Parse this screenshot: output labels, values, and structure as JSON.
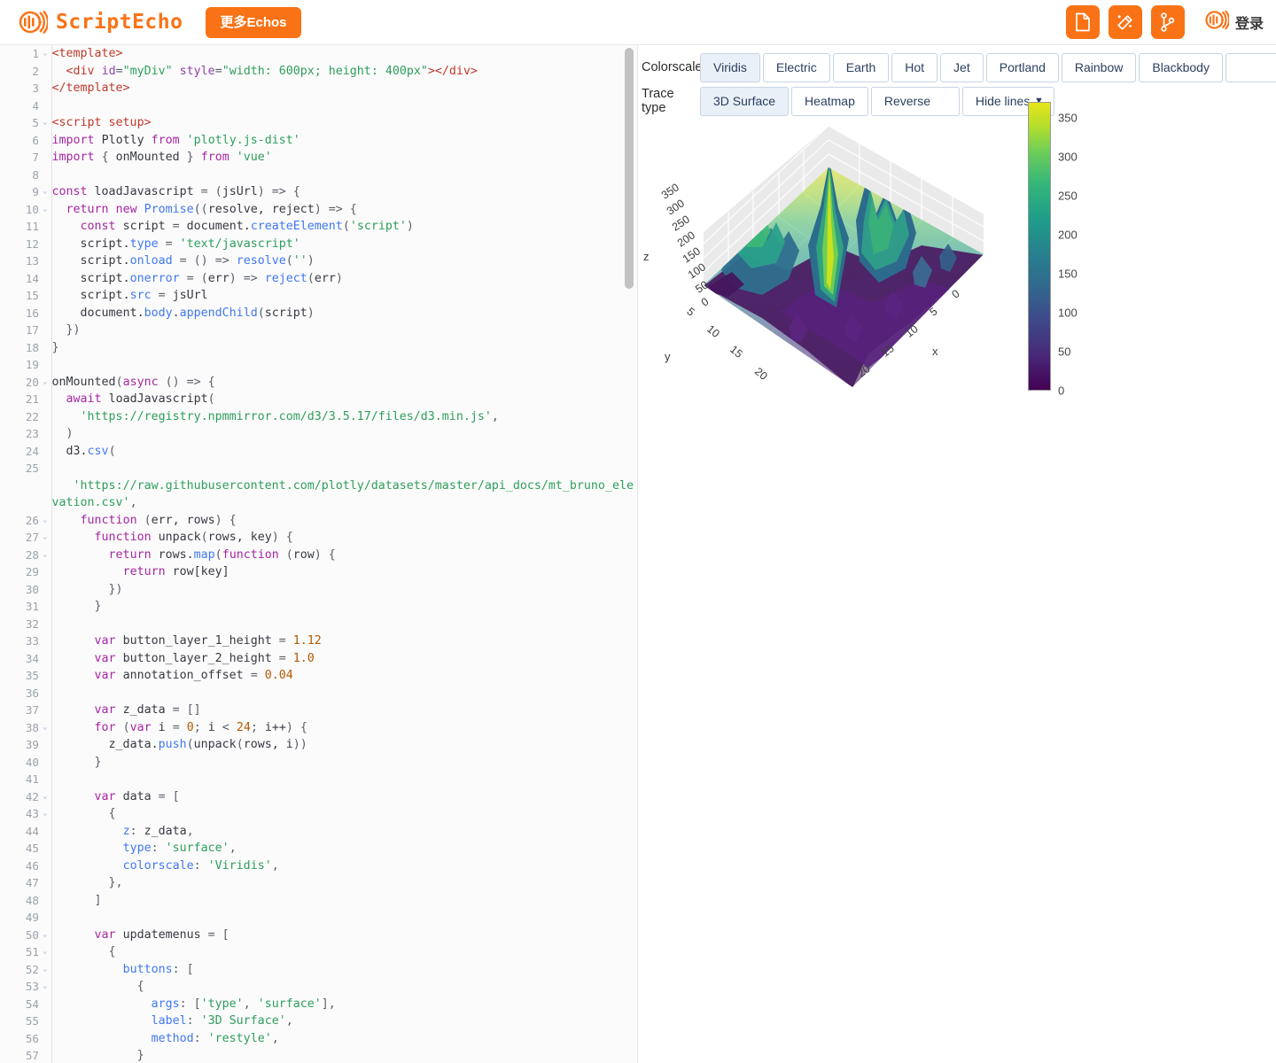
{
  "header": {
    "brand_name": "ScriptEcho",
    "logo_icon": "echo-wave-logo",
    "more_button_label": "更多Echos",
    "action_buttons": [
      {
        "name": "new-document-button",
        "icon": "document-icon"
      },
      {
        "name": "magic-wand-button",
        "icon": "magic-wand-icon"
      },
      {
        "name": "branch-button",
        "icon": "git-branch-icon"
      }
    ],
    "login_label": "登录",
    "login_icon": "echo-wave-logo",
    "accent_color": "#f97316"
  },
  "editor": {
    "name": "vue-code-editor",
    "language": "vue",
    "first_visible_line": 1,
    "last_visible_line": 57,
    "scrollbar_visible": true,
    "lines": [
      {
        "n": 1,
        "fold": true,
        "html": "<span class=\"tag\">&lt;template&gt;</span>"
      },
      {
        "n": 2,
        "fold": false,
        "html": "  <span class=\"tag\">&lt;div</span> <span class=\"attr\">id</span><span class=\"punc\">=</span><span class=\"str\">\"myDiv\"</span> <span class=\"attr\">style</span><span class=\"punc\">=</span><span class=\"str\">\"width: 600px; height: 400px\"</span><span class=\"tag\">&gt;&lt;/div&gt;</span>"
      },
      {
        "n": 3,
        "fold": false,
        "html": "<span class=\"tag\">&lt;/template&gt;</span>"
      },
      {
        "n": 4,
        "fold": false,
        "html": ""
      },
      {
        "n": 5,
        "fold": true,
        "html": "<span class=\"tag\">&lt;script setup&gt;</span>"
      },
      {
        "n": 6,
        "fold": false,
        "html": "<span class=\"kw\">import</span> <span class=\"plain\">Plotly</span> <span class=\"kw\">from</span> <span class=\"str\">'plotly.js-dist'</span>"
      },
      {
        "n": 7,
        "fold": false,
        "html": "<span class=\"kw\">import</span> <span class=\"punc\">{</span> <span class=\"plain\">onMounted</span> <span class=\"punc\">}</span> <span class=\"kw\">from</span> <span class=\"str\">'vue'</span>"
      },
      {
        "n": 8,
        "fold": false,
        "html": ""
      },
      {
        "n": 9,
        "fold": true,
        "html": "<span class=\"kw\">const</span> <span class=\"plain\">loadJavascript</span> <span class=\"punc\">=</span> <span class=\"punc\">(</span><span class=\"plain\">jsUrl</span><span class=\"punc\">) =&gt; {</span>"
      },
      {
        "n": 10,
        "fold": true,
        "html": "  <span class=\"kw\">return</span> <span class=\"kw\">new</span> <span class=\"fn\">Promise</span><span class=\"punc\">((</span><span class=\"plain\">resolve, reject</span><span class=\"punc\">) =&gt; {</span>"
      },
      {
        "n": 11,
        "fold": false,
        "html": "    <span class=\"kw\">const</span> <span class=\"plain\">script</span> <span class=\"punc\">=</span> <span class=\"plain\">document.</span><span class=\"fn\">createElement</span><span class=\"punc\">(</span><span class=\"str\">'script'</span><span class=\"punc\">)</span>"
      },
      {
        "n": 12,
        "fold": false,
        "html": "    <span class=\"plain\">script.</span><span class=\"prop\">type</span> <span class=\"punc\">=</span> <span class=\"str\">'text/javascript'</span>"
      },
      {
        "n": 13,
        "fold": false,
        "html": "    <span class=\"plain\">script.</span><span class=\"prop\">onload</span> <span class=\"punc\">=</span> <span class=\"punc\">() =&gt;</span> <span class=\"fn\">resolve</span><span class=\"punc\">(</span><span class=\"str\">''</span><span class=\"punc\">)</span>"
      },
      {
        "n": 14,
        "fold": false,
        "html": "    <span class=\"plain\">script.</span><span class=\"prop\">onerror</span> <span class=\"punc\">=</span> <span class=\"punc\">(</span><span class=\"plain\">err</span><span class=\"punc\">) =&gt;</span> <span class=\"fn\">reject</span><span class=\"punc\">(</span><span class=\"plain\">err</span><span class=\"punc\">)</span>"
      },
      {
        "n": 15,
        "fold": false,
        "html": "    <span class=\"plain\">script.</span><span class=\"prop\">src</span> <span class=\"punc\">=</span> <span class=\"plain\">jsUrl</span>"
      },
      {
        "n": 16,
        "fold": false,
        "html": "    <span class=\"plain\">document.</span><span class=\"prop\">body</span><span class=\"plain\">.</span><span class=\"fn\">appendChild</span><span class=\"punc\">(</span><span class=\"plain\">script</span><span class=\"punc\">)</span>"
      },
      {
        "n": 17,
        "fold": false,
        "html": "  <span class=\"punc\">})</span>"
      },
      {
        "n": 18,
        "fold": false,
        "html": "<span class=\"punc\">}</span>"
      },
      {
        "n": 19,
        "fold": false,
        "html": ""
      },
      {
        "n": 20,
        "fold": true,
        "html": "<span class=\"plain\">onMounted</span><span class=\"punc\">(</span><span class=\"kw\">async</span> <span class=\"punc\">() =&gt; {</span>"
      },
      {
        "n": 21,
        "fold": false,
        "html": "  <span class=\"kw\">await</span> <span class=\"plain\">loadJavascript</span><span class=\"punc\">(</span>"
      },
      {
        "n": 22,
        "fold": false,
        "html": "    <span class=\"str\">'https://registry.npmmirror.com/d3/3.5.17/files/d3.min.js'</span><span class=\"punc\">,</span>"
      },
      {
        "n": 23,
        "fold": false,
        "html": "  <span class=\"punc\">)</span>"
      },
      {
        "n": 24,
        "fold": false,
        "html": "  <span class=\"plain\">d3.</span><span class=\"fn\">csv</span><span class=\"punc\">(</span>"
      },
      {
        "n": 25,
        "fold": false,
        "html": "\n   <span class=\"str\">'https://raw.githubusercontent.com/plotly/datasets/master/api_docs/mt_bruno_elevation.csv'</span><span class=\"punc\">,</span>"
      },
      {
        "n": 26,
        "fold": true,
        "html": "    <span class=\"kw\">function</span> <span class=\"punc\">(</span><span class=\"plain\">err, rows</span><span class=\"punc\">) {</span>"
      },
      {
        "n": 27,
        "fold": true,
        "html": "      <span class=\"kw\">function</span> <span class=\"plain\">unpack</span><span class=\"punc\">(</span><span class=\"plain\">rows, key</span><span class=\"punc\">) {</span>"
      },
      {
        "n": 28,
        "fold": true,
        "html": "        <span class=\"kw\">return</span> <span class=\"plain\">rows.</span><span class=\"fn\">map</span><span class=\"punc\">(</span><span class=\"kw\">function</span> <span class=\"punc\">(</span><span class=\"plain\">row</span><span class=\"punc\">) {</span>"
      },
      {
        "n": 29,
        "fold": false,
        "html": "          <span class=\"kw\">return</span> <span class=\"plain\">row[key]</span>"
      },
      {
        "n": 30,
        "fold": false,
        "html": "        <span class=\"punc\">})</span>"
      },
      {
        "n": 31,
        "fold": false,
        "html": "      <span class=\"punc\">}</span>"
      },
      {
        "n": 32,
        "fold": false,
        "html": ""
      },
      {
        "n": 33,
        "fold": false,
        "html": "      <span class=\"kw\">var</span> <span class=\"plain\">button_layer_1_height</span> <span class=\"punc\">=</span> <span class=\"num\">1.12</span>"
      },
      {
        "n": 34,
        "fold": false,
        "html": "      <span class=\"kw\">var</span> <span class=\"plain\">button_layer_2_height</span> <span class=\"punc\">=</span> <span class=\"num\">1.0</span>"
      },
      {
        "n": 35,
        "fold": false,
        "html": "      <span class=\"kw\">var</span> <span class=\"plain\">annotation_offset</span> <span class=\"punc\">=</span> <span class=\"num\">0.04</span>"
      },
      {
        "n": 36,
        "fold": false,
        "html": ""
      },
      {
        "n": 37,
        "fold": false,
        "html": "      <span class=\"kw\">var</span> <span class=\"plain\">z_data</span> <span class=\"punc\">= []</span>"
      },
      {
        "n": 38,
        "fold": true,
        "html": "      <span class=\"kw\">for</span> <span class=\"punc\">(</span><span class=\"kw\">var</span> <span class=\"plain\">i</span> <span class=\"punc\">=</span> <span class=\"num\">0</span><span class=\"punc\">;</span> <span class=\"plain\">i</span> <span class=\"punc\">&lt;</span> <span class=\"num\">24</span><span class=\"punc\">;</span> <span class=\"plain\">i++</span><span class=\"punc\">) {</span>"
      },
      {
        "n": 39,
        "fold": false,
        "html": "        <span class=\"plain\">z_data.</span><span class=\"fn\">push</span><span class=\"punc\">(</span><span class=\"plain\">unpack</span><span class=\"punc\">(</span><span class=\"plain\">rows, i</span><span class=\"punc\">))</span>"
      },
      {
        "n": 40,
        "fold": false,
        "html": "      <span class=\"punc\">}</span>"
      },
      {
        "n": 41,
        "fold": false,
        "html": ""
      },
      {
        "n": 42,
        "fold": true,
        "html": "      <span class=\"kw\">var</span> <span class=\"plain\">data</span> <span class=\"punc\">= [</span>"
      },
      {
        "n": 43,
        "fold": true,
        "html": "        <span class=\"punc\">{</span>"
      },
      {
        "n": 44,
        "fold": false,
        "html": "          <span class=\"prop\">z</span><span class=\"punc\">:</span> <span class=\"plain\">z_data</span><span class=\"punc\">,</span>"
      },
      {
        "n": 45,
        "fold": false,
        "html": "          <span class=\"prop\">type</span><span class=\"punc\">:</span> <span class=\"str\">'surface'</span><span class=\"punc\">,</span>"
      },
      {
        "n": 46,
        "fold": false,
        "html": "          <span class=\"prop\">colorscale</span><span class=\"punc\">:</span> <span class=\"str\">'Viridis'</span><span class=\"punc\">,</span>"
      },
      {
        "n": 47,
        "fold": false,
        "html": "        <span class=\"punc\">},</span>"
      },
      {
        "n": 48,
        "fold": false,
        "html": "      <span class=\"punc\">]</span>"
      },
      {
        "n": 49,
        "fold": false,
        "html": ""
      },
      {
        "n": 50,
        "fold": true,
        "html": "      <span class=\"kw\">var</span> <span class=\"plain\">updatemenus</span> <span class=\"punc\">= [</span>"
      },
      {
        "n": 51,
        "fold": true,
        "html": "        <span class=\"punc\">{</span>"
      },
      {
        "n": 52,
        "fold": true,
        "html": "          <span class=\"prop\">buttons</span><span class=\"punc\">: [</span>"
      },
      {
        "n": 53,
        "fold": true,
        "html": "            <span class=\"punc\">{</span>"
      },
      {
        "n": 54,
        "fold": false,
        "html": "              <span class=\"prop\">args</span><span class=\"punc\">: [</span><span class=\"str\">'type'</span><span class=\"punc\">,</span> <span class=\"str\">'surface'</span><span class=\"punc\">],</span>"
      },
      {
        "n": 55,
        "fold": false,
        "html": "              <span class=\"prop\">label</span><span class=\"punc\">:</span> <span class=\"str\">'3D Surface'</span><span class=\"punc\">,</span>"
      },
      {
        "n": 56,
        "fold": false,
        "html": "              <span class=\"prop\">method</span><span class=\"punc\">:</span> <span class=\"str\">'restyle'</span><span class=\"punc\">,</span>"
      },
      {
        "n": 57,
        "fold": false,
        "html": "            <span class=\"punc\">}</span>"
      }
    ]
  },
  "preview": {
    "colorscale_label": "Colorscale",
    "colorscale_buttons": [
      "Viridis",
      "Electric",
      "Earth",
      "Hot",
      "Jet",
      "Portland",
      "Rainbow",
      "Blackbody",
      ""
    ],
    "colorscale_selected": "Viridis",
    "trace_label": "Trace type",
    "trace_buttons": [
      "3D Surface",
      "Heatmap"
    ],
    "trace_selected": "3D Surface",
    "reverse_label": "Reverse",
    "hide_lines_label": "Hide lines",
    "hide_lines_caret": "▼"
  },
  "chart_data": {
    "type": "surface",
    "title": "",
    "xlabel": "x",
    "ylabel": "y",
    "zlabel": "z",
    "colorscale": "Viridis",
    "x_ticks": [
      0,
      5,
      10,
      15,
      20
    ],
    "y_ticks": [
      5,
      10,
      15,
      20
    ],
    "z_ticks": [
      0,
      50,
      100,
      150,
      200,
      250,
      300,
      350
    ],
    "xlim": [
      0,
      24
    ],
    "ylim": [
      0,
      24
    ],
    "zlim": [
      0,
      370
    ],
    "colorbar": {
      "ticks": [
        0,
        50,
        100,
        150,
        200,
        250,
        300,
        350
      ],
      "min": 0,
      "max": 370,
      "position": "right"
    },
    "grid": true,
    "legend": "none",
    "dataset": "mt_bruno_elevation",
    "rows": 24,
    "description": "3D surface of Mt Bruno elevation data; peak elevation ~370 near the centre, with a ridge of secondary peaks around 200-260 and a broad low plain near 0-50."
  }
}
